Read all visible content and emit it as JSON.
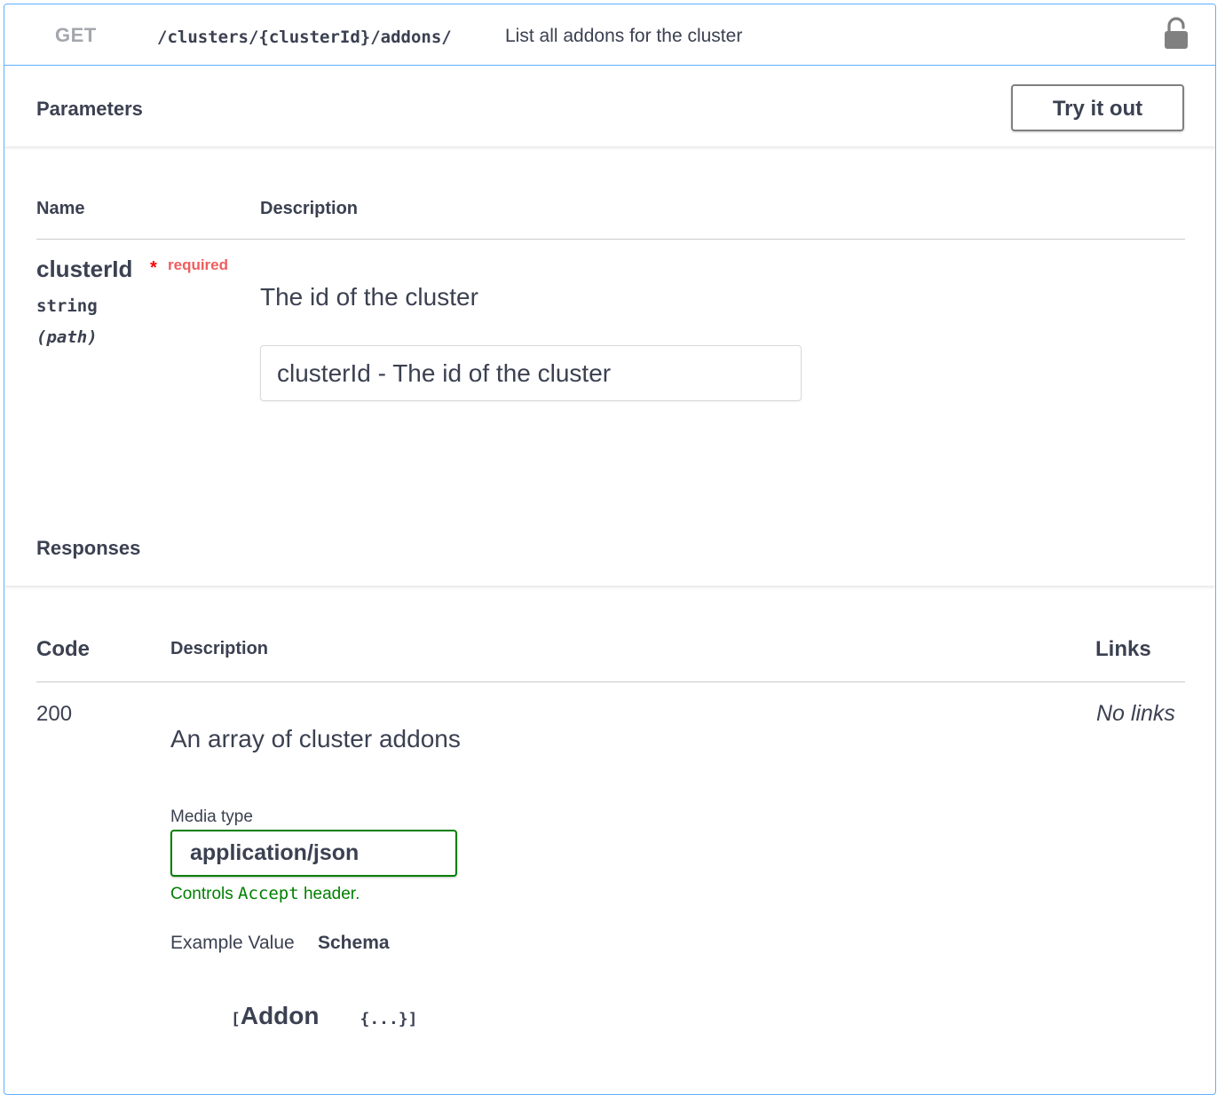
{
  "operation": {
    "method": "GET",
    "path": "/clusters/{clusterId}/addons/",
    "summary": "List all addons for the cluster"
  },
  "parameters": {
    "title": "Parameters",
    "try_button": "Try it out",
    "columns": {
      "name": "Name",
      "description": "Description"
    },
    "items": [
      {
        "name": "clusterId",
        "required_star": "*",
        "required_label": "required",
        "type": "string",
        "in": "(path)",
        "description": "The id of the cluster",
        "input_placeholder": "clusterId - The id of the cluster"
      }
    ]
  },
  "responses": {
    "title": "Responses",
    "columns": {
      "code": "Code",
      "description": "Description",
      "links": "Links"
    },
    "items": [
      {
        "code": "200",
        "description": "An array of cluster addons",
        "links": "No links",
        "media_type_label": "Media type",
        "media_type": "application/json",
        "accept_note_prefix": "Controls",
        "accept_note_code": "Accept",
        "accept_note_suffix": "header.",
        "tabs": [
          "Example Value",
          "Schema"
        ],
        "active_tab": "Schema",
        "schema": {
          "open_bracket": "[",
          "model": "Addon",
          "collapsed": "{...}",
          "close_bracket": "]"
        }
      }
    ]
  },
  "colors": {
    "get_accent": "#61affe",
    "required": "#ff0000",
    "media_border": "#008000",
    "text": "#3b4151"
  }
}
